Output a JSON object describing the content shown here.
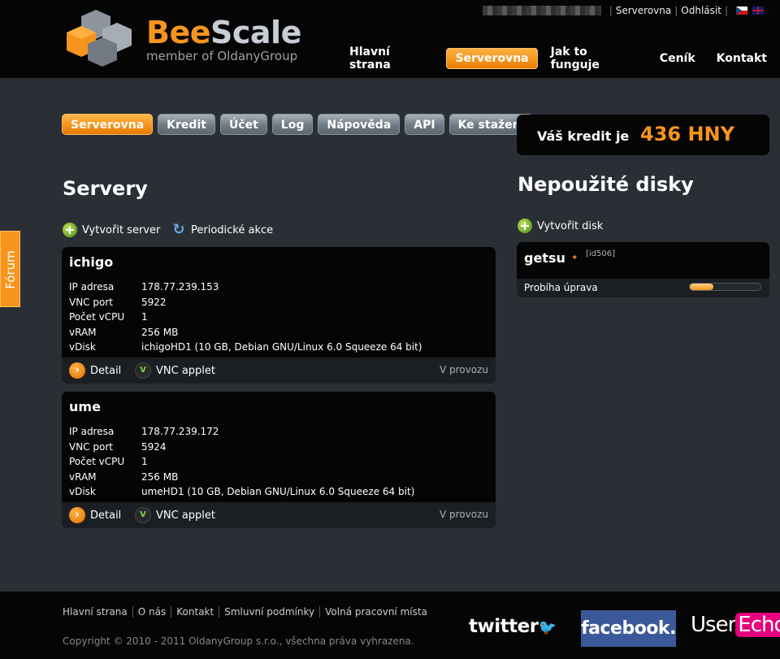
{
  "header": {
    "logo_bee": "Bee",
    "logo_scale": "Scale",
    "logo_sub": "member of OldanyGroup",
    "top_links": [
      "Serverovna",
      "Odhlásit"
    ],
    "nav": [
      {
        "label": "Hlavní strana",
        "active": false
      },
      {
        "label": "Serverovna",
        "active": true
      },
      {
        "label": "Jak to funguje",
        "active": false
      },
      {
        "label": "Ceník",
        "active": false
      },
      {
        "label": "Kontakt",
        "active": false
      }
    ]
  },
  "tabs": [
    {
      "label": "Serverovna",
      "active": true
    },
    {
      "label": "Kredit",
      "active": false
    },
    {
      "label": "Účet",
      "active": false
    },
    {
      "label": "Log",
      "active": false
    },
    {
      "label": "Nápověda",
      "active": false
    },
    {
      "label": "API",
      "active": false
    },
    {
      "label": "Ke stažení",
      "active": false
    }
  ],
  "credit": {
    "label": "Váš kredit je",
    "value": "436 HNY"
  },
  "servers_section": {
    "title": "Servery",
    "create_label": "Vytvořit server",
    "periodic_label": "Periodické akce"
  },
  "servers": [
    {
      "name": "ichigo",
      "props": [
        {
          "k": "IP adresa",
          "v": "178.77.239.153"
        },
        {
          "k": "VNC port",
          "v": "5922"
        },
        {
          "k": "Počet vCPU",
          "v": "1"
        },
        {
          "k": "vRAM",
          "v": "256 MB"
        },
        {
          "k": "vDisk",
          "v": "ichigoHD1 (10 GB, Debian GNU/Linux 6.0 Squeeze 64 bit)"
        }
      ],
      "detail": "Detail",
      "vnc": "VNC applet",
      "status": "V provozu"
    },
    {
      "name": "ume",
      "props": [
        {
          "k": "IP adresa",
          "v": "178.77.239.172"
        },
        {
          "k": "VNC port",
          "v": "5924"
        },
        {
          "k": "Počet vCPU",
          "v": "1"
        },
        {
          "k": "vRAM",
          "v": "256 MB"
        },
        {
          "k": "vDisk",
          "v": "umeHD1 (10 GB, Debian GNU/Linux 6.0 Squeeze 64 bit)"
        }
      ],
      "detail": "Detail",
      "vnc": "VNC applet",
      "status": "V provozu"
    }
  ],
  "disks_section": {
    "title": "Nepoužité disky",
    "create_label": "Vytvořit disk"
  },
  "disk": {
    "name": "getsu",
    "id": "[id506]",
    "status": "Probíha úprava",
    "progress": 0.33
  },
  "forum_label": "Fórum",
  "footer": {
    "links": [
      "Hlavní strana",
      "O nás",
      "Kontakt",
      "Smluvní podmínky",
      "Volná pracovní místa"
    ],
    "copyright": "Copyright © 2010 - 2011 OldanyGroup s.r.o., všechna práva vyhrazena.",
    "twitter": "twitter",
    "facebook": "facebook.",
    "userecho_user": "User",
    "userecho_echo": "Echo"
  },
  "colors": {
    "accent": "#f7941d",
    "card_bg": "#050505",
    "page_bg": "#2a2f35"
  },
  "icons": [
    "beescale-logo",
    "plus-icon",
    "refresh-icon",
    "detail-arrow-icon",
    "vnc-icon",
    "bee-icon",
    "forum-icon",
    "twitter-bird-icon"
  ]
}
